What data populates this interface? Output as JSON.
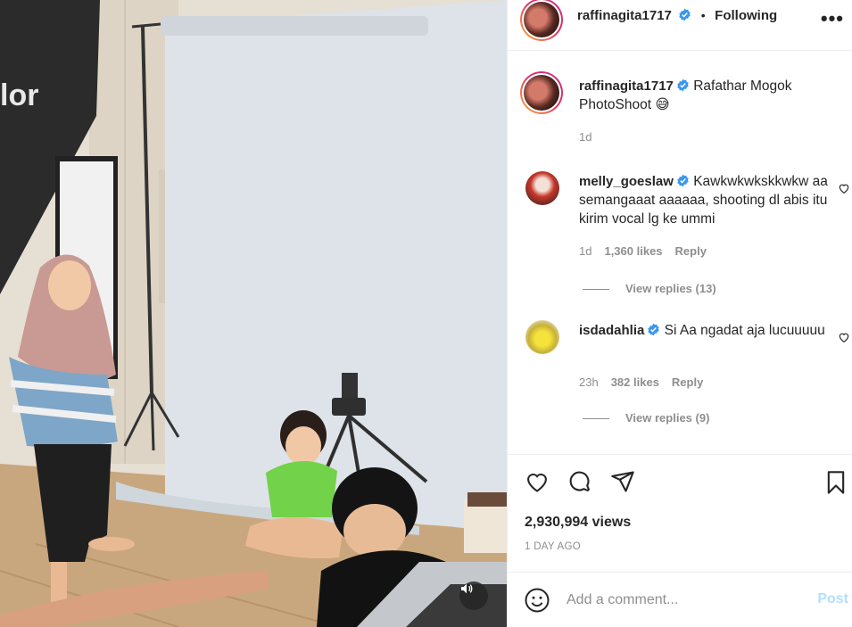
{
  "post": {
    "author": "raffinagita1717",
    "follow_state": "Following",
    "more_icon": "more-dots-icon",
    "caption": "Rafathar Mogok PhotoShoot 😅",
    "caption_time": "1d"
  },
  "comments": [
    {
      "username": "melly_goeslaw",
      "text": "Kawkwkwkskkwkw aa semangaaat aaaaaa, shooting dl abis itu kirim vocal lg ke ummi",
      "time": "1d",
      "likes": "1,360 likes",
      "reply": "Reply",
      "view_replies": "View replies (13)"
    },
    {
      "username": "isdadahlia",
      "text": "Si Aa ngadat aja lucuuuuu",
      "time": "23h",
      "likes": "382 likes",
      "reply": "Reply",
      "view_replies": "View replies (9)"
    }
  ],
  "stats": {
    "views": "2,930,994 views",
    "posted": "1 DAY AGO"
  },
  "composer": {
    "placeholder": "Add a comment...",
    "post_label": "Post"
  },
  "media": {
    "backdrop_text": "lor"
  },
  "colors": {
    "verified": "#3897f0",
    "post_disabled": "#b2dffc",
    "secondary_text": "#8e8e8e"
  }
}
